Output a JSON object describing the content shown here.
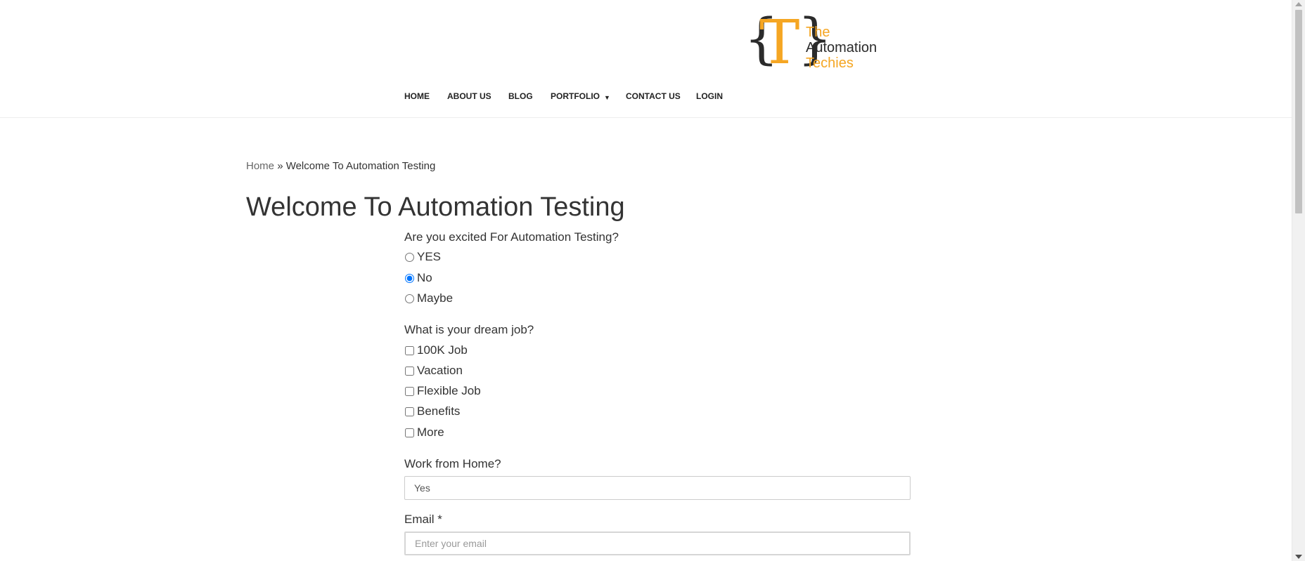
{
  "header": {
    "logo": {
      "glyph": "{T}",
      "line1": "The",
      "line2": "Automation",
      "line3": "Techies",
      "accent_color": "#f5a623",
      "dark_color": "#2b2b2b"
    },
    "nav": [
      {
        "label": "HOME"
      },
      {
        "label": "ABOUT US"
      },
      {
        "label": "BLOG"
      },
      {
        "label": "PORTFOLIO",
        "has_dropdown": true
      },
      {
        "label": "CONTACT US"
      },
      {
        "label": "LOGIN"
      }
    ]
  },
  "breadcrumb": {
    "home": "Home",
    "separator": "»",
    "current": "Welcome To Automation Testing"
  },
  "page_title": "Welcome To Automation Testing",
  "form": {
    "q1": {
      "label": "Are you excited For Automation Testing?",
      "options": [
        {
          "label": "YES",
          "checked": false
        },
        {
          "label": "No",
          "checked": true
        },
        {
          "label": "Maybe",
          "checked": false
        }
      ]
    },
    "q2": {
      "label": "What is your dream job?",
      "options": [
        {
          "label": "100K Job",
          "checked": false
        },
        {
          "label": "Vacation",
          "checked": false
        },
        {
          "label": "Flexible Job",
          "checked": false
        },
        {
          "label": "Benefits",
          "checked": false
        },
        {
          "label": "More",
          "checked": false
        }
      ]
    },
    "wfh": {
      "label": "Work from Home?",
      "value": "Yes"
    },
    "email": {
      "label": "Email *",
      "placeholder": "Enter your email",
      "value": ""
    }
  }
}
